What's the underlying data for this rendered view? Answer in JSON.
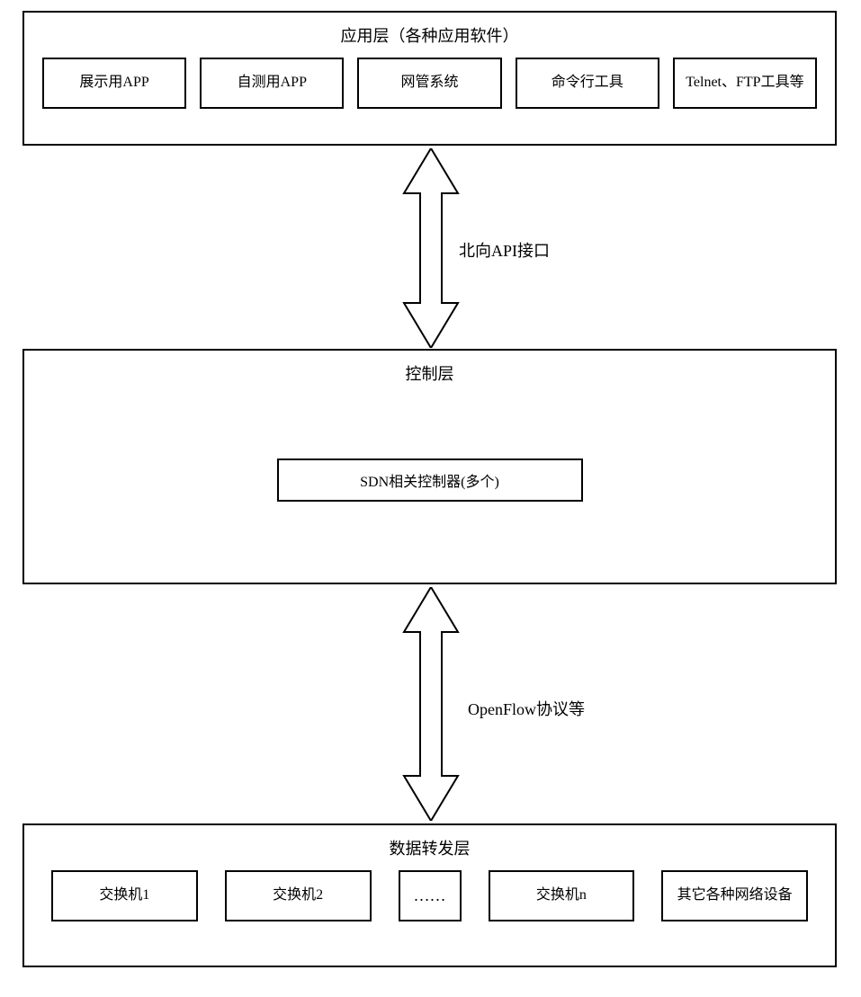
{
  "application_layer": {
    "title": "应用层（各种应用软件）",
    "boxes": [
      "展示用APP",
      "自测用APP",
      "网管系统",
      "命令行工具",
      "Telnet、FTP工具等"
    ]
  },
  "northbound_label": "北向API接口",
  "control_layer": {
    "title": "控制层",
    "inner": "SDN相关控制器(多个)"
  },
  "southbound_label": "OpenFlow协议等",
  "data_layer": {
    "title": "数据转发层",
    "boxes": [
      "交换机1",
      "交换机2",
      "……",
      "交换机n",
      "其它各种网络设备"
    ]
  }
}
